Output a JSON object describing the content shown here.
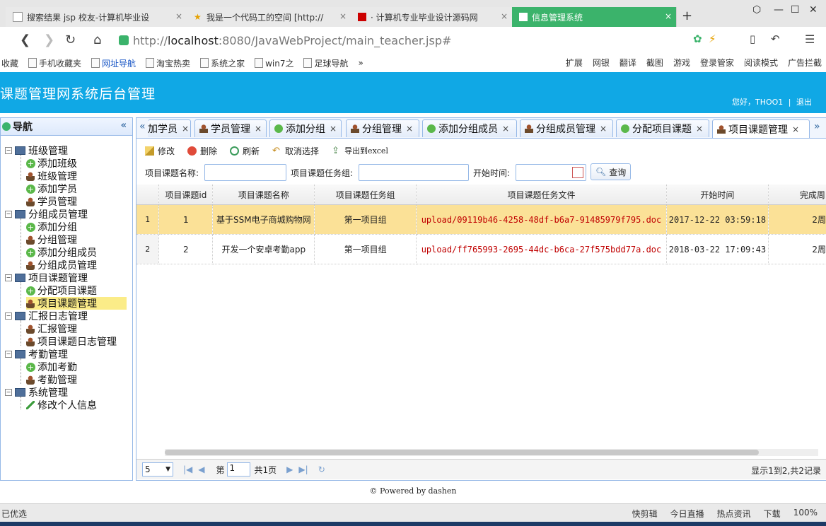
{
  "browser": {
    "tabs": [
      {
        "title": "搜索结果 jsp 校友-计算机毕业设",
        "active": false
      },
      {
        "title": "我是一个代码工的空间 [http://",
        "active": false
      },
      {
        "title": "· 计算机专业毕业设计源码网",
        "active": false
      },
      {
        "title": "信息管理系统",
        "active": true
      }
    ],
    "new_tab": "+",
    "url_prefix": "http://",
    "url_host": "localhost",
    "url_rest": ":8080/JavaWebProject/main_teacher.jsp#",
    "bookmarks": [
      "收藏",
      "手机收藏夹",
      "网址导航",
      "淘宝热卖",
      "系统之家",
      "win7之",
      "足球导航",
      "»"
    ],
    "bookmarks_right": [
      "扩展",
      "网银",
      "翻译",
      "截图",
      "游戏",
      "登录管家",
      "阅读模式",
      "广告拦截"
    ]
  },
  "header": {
    "title": "课题管理网系统后台管理",
    "greeting": "您好，THOO1",
    "separator": "|",
    "logout": "退出"
  },
  "nav": {
    "title": "导航",
    "collapse": "«",
    "groups": [
      {
        "label": "班级管理",
        "items": [
          {
            "label": "添加班级",
            "icon": "add"
          },
          {
            "label": "班级管理",
            "icon": "person"
          }
        ]
      },
      {
        "label": "",
        "items": [
          {
            "label": "添加学员",
            "icon": "add"
          },
          {
            "label": "学员管理",
            "icon": "person"
          }
        ]
      },
      {
        "label": "分组成员管理",
        "items": [
          {
            "label": "添加分组",
            "icon": "add"
          },
          {
            "label": "分组管理",
            "icon": "person"
          },
          {
            "label": "添加分组成员",
            "icon": "add"
          },
          {
            "label": "分组成员管理",
            "icon": "person"
          }
        ]
      },
      {
        "label": "项目课题管理",
        "items": [
          {
            "label": "分配项目课题",
            "icon": "add"
          },
          {
            "label": "项目课题管理",
            "icon": "person"
          }
        ]
      },
      {
        "label": "汇报日志管理",
        "items": [
          {
            "label": "汇报管理",
            "icon": "person"
          },
          {
            "label": "项目课题日志管理",
            "icon": "person"
          }
        ]
      },
      {
        "label": "考勤管理",
        "items": [
          {
            "label": "添加考勤",
            "icon": "add"
          },
          {
            "label": "考勤管理",
            "icon": "person"
          }
        ]
      },
      {
        "label": "系统管理",
        "items": [
          {
            "label": "修改个人信息",
            "icon": "pencil"
          }
        ]
      }
    ]
  },
  "tabs": [
    {
      "label": "加学员",
      "icon": "none"
    },
    {
      "label": "学员管理",
      "icon": "person"
    },
    {
      "label": "添加分组",
      "icon": "add"
    },
    {
      "label": "分组管理",
      "icon": "person"
    },
    {
      "label": "添加分组成员",
      "icon": "add"
    },
    {
      "label": "分组成员管理",
      "icon": "person"
    },
    {
      "label": "分配项目课题",
      "icon": "add"
    },
    {
      "label": "项目课题管理",
      "icon": "person"
    }
  ],
  "tab_close": "×",
  "toolbar": {
    "edit": "修改",
    "delete": "删除",
    "refresh": "刷新",
    "unselect": "取消选择",
    "export": "导出到excel"
  },
  "search": {
    "name_label": "项目课题名称:",
    "group_label": "项目课题任务组:",
    "start_label": "开始时间:",
    "query": "查询"
  },
  "grid": {
    "columns": [
      "项目课题id",
      "项目课题名称",
      "项目课题任务组",
      "项目课题任务文件",
      "开始时间",
      "完成周"
    ],
    "rows": [
      {
        "rownum": "1",
        "id": "1",
        "name": "基于SSM电子商城购物网",
        "group": "第一项目组",
        "file": "upload/09119b46-4258-48df-b6a7-91485979f795.doc",
        "start": "2017-12-22 03:59:18",
        "finish": "2周"
      },
      {
        "rownum": "2",
        "id": "2",
        "name": "开发一个安卓考勤app",
        "group": "第一项目组",
        "file": "upload/ff765993-2695-44dc-b6ca-27f575bdd77a.doc",
        "start": "2018-03-22 17:09:43",
        "finish": "2周"
      }
    ]
  },
  "pager": {
    "page_size": "5",
    "page_prefix": "第",
    "page": "1",
    "page_total": "共1页",
    "info": "显示1到2,共2记录"
  },
  "footer": "© Powered by dashen",
  "status": {
    "left": "已优选",
    "right": [
      "快剪辑",
      "今日直播",
      "热点资讯",
      "下载",
      "100%"
    ]
  }
}
